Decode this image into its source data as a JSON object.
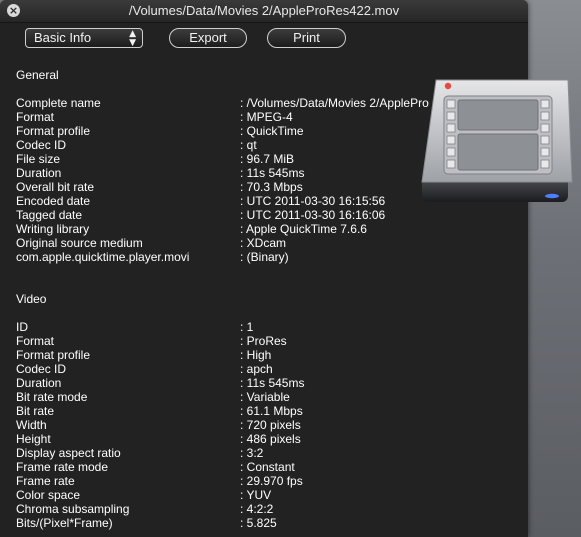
{
  "window": {
    "title": "/Volumes/Data/Movies 2/AppleProRes422.mov"
  },
  "toolbar": {
    "view_select": "Basic Info",
    "export_label": "Export",
    "print_label": "Print"
  },
  "icons": {
    "close": "close-icon",
    "app": "media-drive-icon"
  },
  "general": {
    "title": "General",
    "rows": [
      {
        "key": "Complete name",
        "value": ": /Volumes/Data/Movies 2/ApplePro"
      },
      {
        "key": "Format",
        "value": ": MPEG-4"
      },
      {
        "key": "Format profile",
        "value": ": QuickTime"
      },
      {
        "key": "Codec ID",
        "value": ": qt"
      },
      {
        "key": "File size",
        "value": ": 96.7 MiB"
      },
      {
        "key": "Duration",
        "value": ": 11s 545ms"
      },
      {
        "key": "Overall bit rate",
        "value": ": 70.3 Mbps"
      },
      {
        "key": "Encoded date",
        "value": ": UTC 2011-03-30 16:15:56"
      },
      {
        "key": "Tagged date",
        "value": ": UTC 2011-03-30 16:16:06"
      },
      {
        "key": "Writing library",
        "value": ": Apple QuickTime 7.6.6"
      },
      {
        "key": "Original source medium",
        "value": ": XDcam"
      },
      {
        "key": "com.apple.quicktime.player.movi",
        "value": ": (Binary)"
      }
    ]
  },
  "video": {
    "title": "Video",
    "rows": [
      {
        "key": "ID",
        "value": ": 1"
      },
      {
        "key": "Format",
        "value": ": ProRes"
      },
      {
        "key": "Format profile",
        "value": ": High"
      },
      {
        "key": "Codec ID",
        "value": ": apch"
      },
      {
        "key": "Duration",
        "value": ": 11s 545ms"
      },
      {
        "key": "Bit rate mode",
        "value": ": Variable"
      },
      {
        "key": "Bit rate",
        "value": ": 61.1 Mbps"
      },
      {
        "key": "Width",
        "value": ": 720 pixels"
      },
      {
        "key": "Height",
        "value": ": 486 pixels"
      },
      {
        "key": "Display aspect ratio",
        "value": ": 3:2"
      },
      {
        "key": "Frame rate mode",
        "value": ": Constant"
      },
      {
        "key": "Frame rate",
        "value": ": 29.970 fps"
      },
      {
        "key": "Color space",
        "value": ": YUV"
      },
      {
        "key": "Chroma subsampling",
        "value": ": 4:2:2"
      },
      {
        "key": "Bits/(Pixel*Frame)",
        "value": ": 5.825"
      }
    ]
  }
}
